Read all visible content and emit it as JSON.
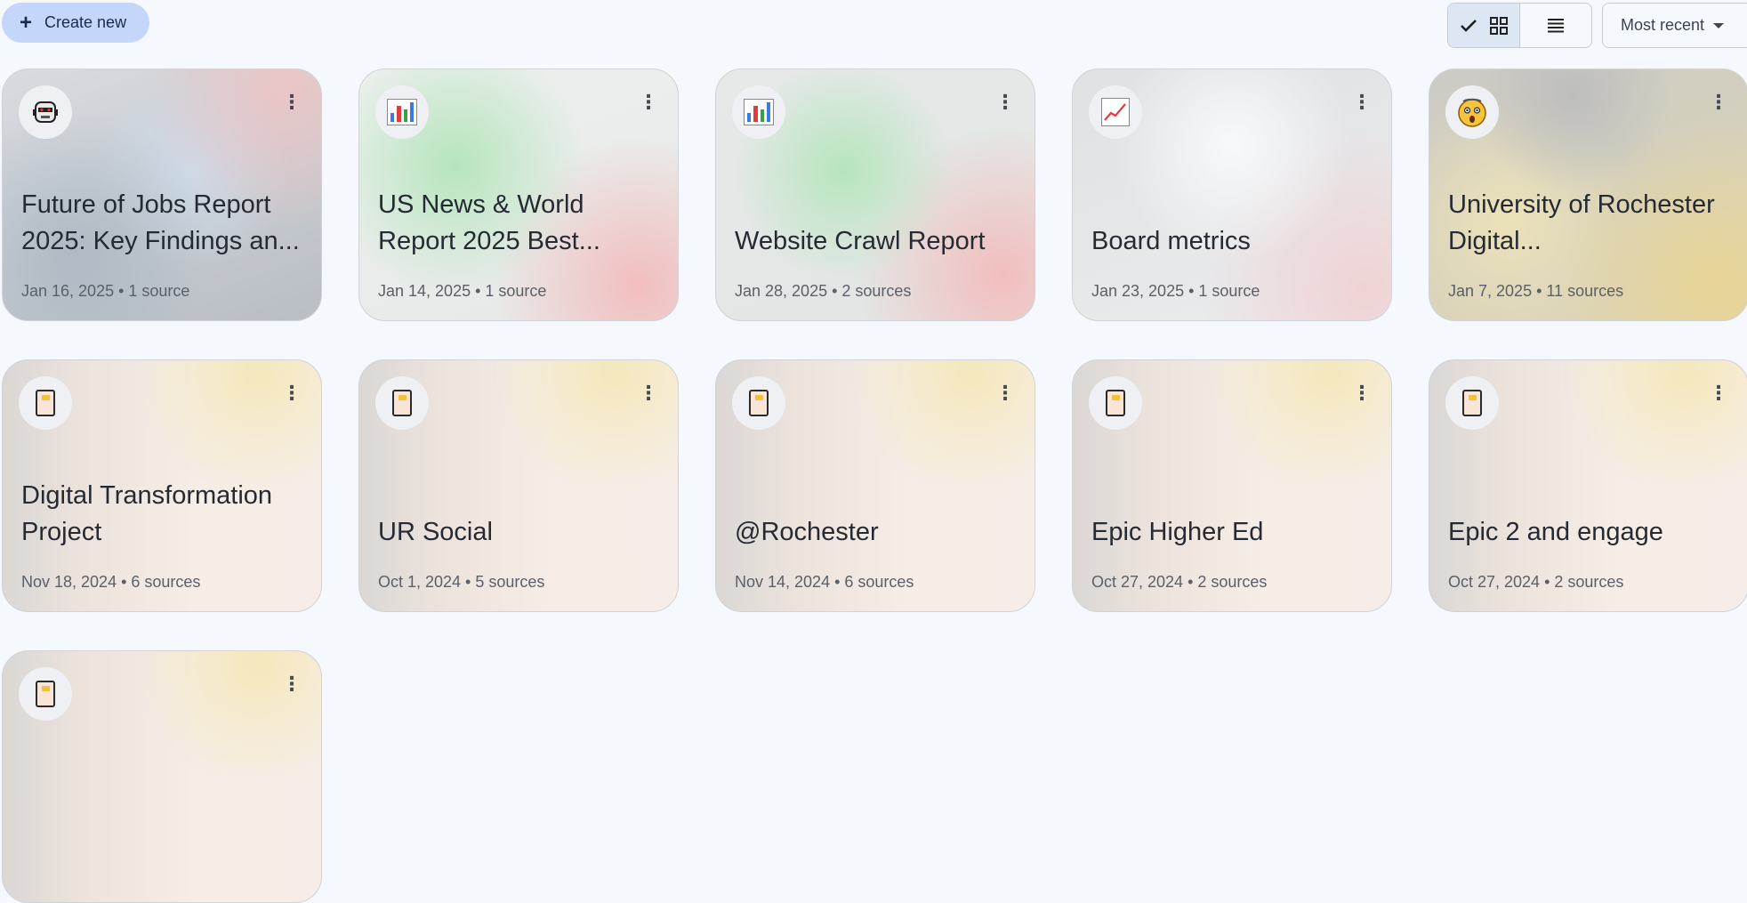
{
  "toolbar": {
    "create_label": "Create new",
    "sort_label": "Most recent"
  },
  "notebooks": [
    {
      "title": "Future of Jobs Report 2025: Key Findings an...",
      "meta": "Jan 16, 2025 • 1 source",
      "icon": "robot-icon"
    },
    {
      "title": "US News & World Report 2025 Best...",
      "meta": "Jan 14, 2025 • 1 source",
      "icon": "bar-chart-icon"
    },
    {
      "title": "Website Crawl Report",
      "meta": "Jan 28, 2025 • 2 sources",
      "icon": "bar-chart-icon"
    },
    {
      "title": "Board metrics",
      "meta": "Jan 23, 2025 • 1 source",
      "icon": "line-chart-icon"
    },
    {
      "title": "University of Rochester Digital...",
      "meta": "Jan 7, 2025 • 11 sources",
      "icon": "shocked-face-icon"
    },
    {
      "title": "Digital Transformation Project",
      "meta": "Nov 18, 2024 • 6 sources",
      "icon": "notebook-icon"
    },
    {
      "title": "UR Social",
      "meta": "Oct 1, 2024 • 5 sources",
      "icon": "notebook-icon"
    },
    {
      "title": "@Rochester",
      "meta": "Nov 14, 2024 • 6 sources",
      "icon": "notebook-icon"
    },
    {
      "title": "Epic Higher Ed",
      "meta": "Oct 27, 2024 • 2 sources",
      "icon": "notebook-icon"
    },
    {
      "title": "Epic 2 and engage",
      "meta": "Oct 27, 2024 • 2 sources",
      "icon": "notebook-icon"
    },
    {
      "title": "",
      "meta": "",
      "icon": "notebook-icon"
    }
  ]
}
